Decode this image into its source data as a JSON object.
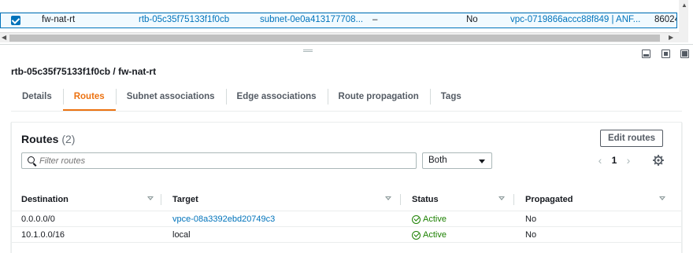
{
  "selected_row": {
    "name": "fw-nat-rt",
    "route_table_id": "rtb-05c35f75133f1f0cb",
    "subnet": "subnet-0e0a413177708...",
    "edge": "–",
    "main": "No",
    "vpc": "vpc-0719866accc88f849 | ANF...",
    "owner": "86024"
  },
  "panel": {
    "title": "rtb-05c35f75133f1f0cb / fw-nat-rt"
  },
  "tabs": [
    {
      "label": "Details"
    },
    {
      "label": "Routes"
    },
    {
      "label": "Subnet associations"
    },
    {
      "label": "Edge associations"
    },
    {
      "label": "Route propagation"
    },
    {
      "label": "Tags"
    }
  ],
  "active_tab": "Routes",
  "routes": {
    "heading": "Routes",
    "count": "(2)",
    "edit_button": "Edit routes",
    "filter_placeholder": "Filter routes",
    "filter_select": "Both",
    "page": "1",
    "columns": [
      "Destination",
      "Target",
      "Status",
      "Propagated"
    ],
    "rows": [
      {
        "destination": "0.0.0.0/0",
        "target": "vpce-08a3392ebd20749c3",
        "target_is_link": true,
        "status": "Active",
        "propagated": "No"
      },
      {
        "destination": "10.1.0.0/16",
        "target": "local",
        "target_is_link": false,
        "status": "Active",
        "propagated": "No"
      }
    ]
  },
  "colors": {
    "accent": "#ec7211",
    "link": "#0073bb",
    "success": "#1d8102"
  }
}
